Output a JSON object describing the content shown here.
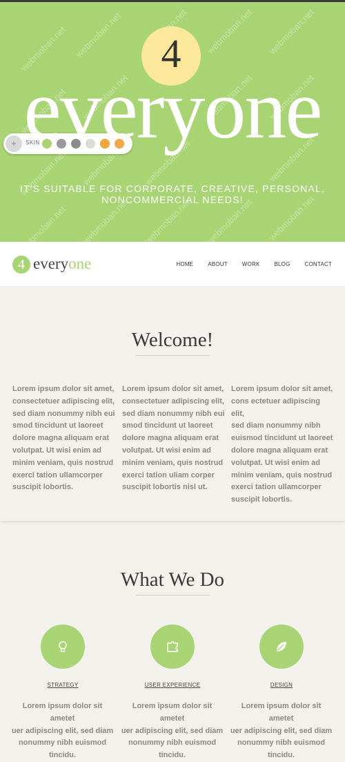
{
  "hero": {
    "number": "4",
    "word": "everyone",
    "tagline_line1": "IT'S SUITABLE FOR CORPORATE, CREATIVE, PERSONAL,",
    "tagline_line2": "NONCOMMERCIAL NEEDS!",
    "watermark": "webmoban.net"
  },
  "skin": {
    "label": "SKIN",
    "toggle_symbol": "+",
    "swatches": [
      "#a9d474",
      "#9a9a9a",
      "#8c8c8c",
      "#dcdcd6",
      "#f0a63a",
      "#f3a74a"
    ]
  },
  "nav": {
    "logo_number": "4",
    "logo_word_1": "every",
    "logo_word_2": "one",
    "menu": [
      "HOME",
      "ABOUT",
      "WORK",
      "BLOG",
      "CONTACT"
    ]
  },
  "welcome": {
    "title": "Welcome!",
    "columns": [
      [
        "Lorem ipsum dolor sit amet,",
        "consectetuer adipiscing elit,",
        "sed diam nonummy nibh eui",
        "smod tincidunt ut laoreet",
        "dolore magna aliquam erat",
        "volutpat. Ut wisi enim ad",
        "minim veniam, quis nostrud",
        "exerci tation ullamcorper",
        "suscipit lobortis."
      ],
      [
        "Lorem ipsum dolor sit amet,",
        "consectetuer adipiscing elit,",
        "sed diam nonummy nibh eui",
        "smod tincidunt ut laoreet",
        "dolore magna aliquam erat",
        "volutpat. Ut wisi enim ad",
        "minim veniam, quis nostrud",
        "exerci tation uliam corper",
        "suscipit lobortis nisl ut."
      ],
      [
        "Lorem ipsum dolor sit amet,",
        "cons ectetuer adipiscing elit,",
        "sed diam nonummy nibh",
        "euismod tincidunt ut laoreet",
        "dolore magna aliquam erat",
        "volutpat. Ut wisi enim ad",
        "minim veniam, quis nostrud",
        "exerci tation ullamcorper",
        "suscipit lobortis."
      ]
    ]
  },
  "whatwedo": {
    "title": "What We Do",
    "services": [
      {
        "label": "STRATEGY",
        "icon": "lightbulb-icon",
        "lines": [
          "Lorem ipsum dolor sit",
          "ametet",
          "uer adipiscing elit, sed diam",
          "nonummy nibh euismod",
          "tincidu."
        ]
      },
      {
        "label": "USER EXPERIENCE",
        "icon": "puzzle-icon",
        "lines": [
          "Lorem ipsum dolor sit",
          "ametet",
          "uer adipiscing elit, sed diam",
          "nonummy nibh euismod",
          "tincidu."
        ]
      },
      {
        "label": "DESIGN",
        "icon": "leaf-icon",
        "lines": [
          "Lorem ipsum dolor sit",
          "ametet",
          "uer adipiscing elit, sed diam",
          "nonummy nibh euismod",
          "tincidu."
        ]
      }
    ]
  },
  "colors": {
    "accent": "#a9d474",
    "hero_circle": "#fbe89a"
  }
}
